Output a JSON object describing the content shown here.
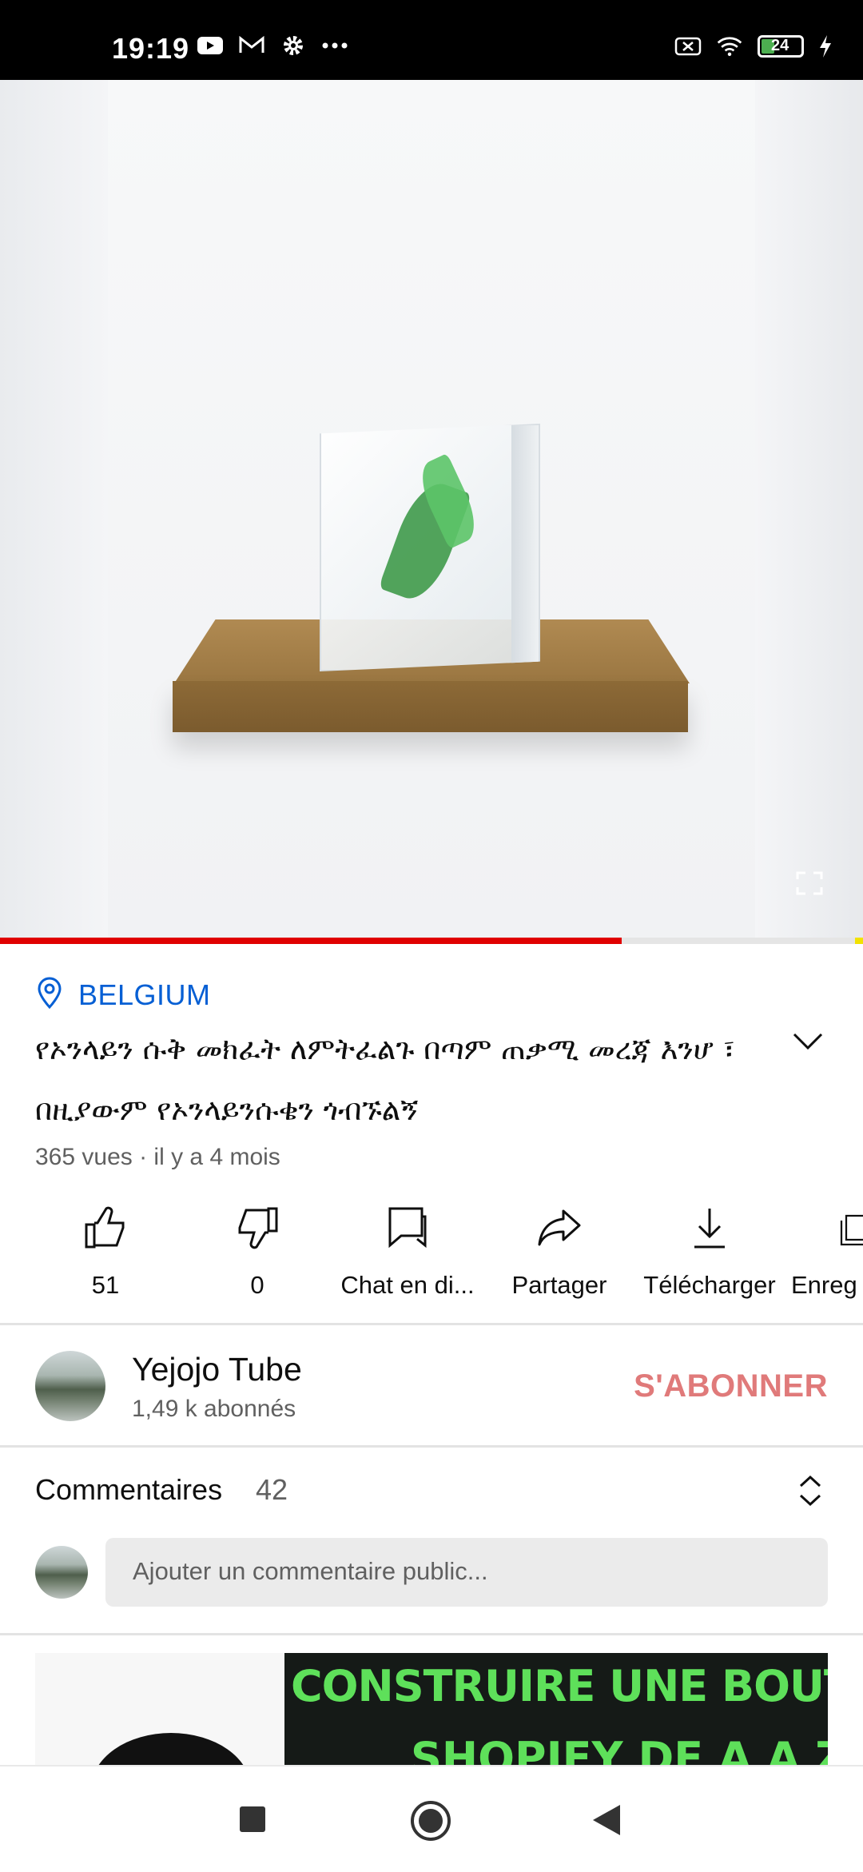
{
  "status_bar": {
    "time": "19:19",
    "battery": "24",
    "icons": [
      "youtube-icon",
      "gmail-icon",
      "settings-icon",
      "more-icon",
      "no-sim-icon",
      "wifi-icon",
      "battery-icon",
      "charging-icon"
    ]
  },
  "video": {
    "progress_fraction": 0.72
  },
  "location": {
    "label": "BELGIUM"
  },
  "video_info": {
    "title": "የኦንላይን ሱቅ መክፈት ለምትፈልጉ በጣም ጠቃሚ መረጃ እንሆ ፣ በዚያውም የኦንላይንሱቄን ጎብኙልኝ",
    "meta": "365 vues · il y a 4 mois"
  },
  "actions": {
    "like": "51",
    "dislike": "0",
    "chat": "Chat en di...",
    "share": "Partager",
    "download": "Télécharger",
    "save": "Enreg"
  },
  "channel": {
    "name": "Yejojo Tube",
    "subscribers": "1,49 k abonnés",
    "subscribe_label": "S'ABONNER"
  },
  "comments": {
    "header": "Commentaires",
    "count": "42",
    "placeholder": "Ajouter un commentaire public..."
  },
  "next_video": {
    "thumb_line1": "CONSTRUIRE UNE BOUTIQUE",
    "thumb_line2": "SHOPIFY DE A A Z"
  },
  "colors": {
    "accent_blue": "#065fd4",
    "progress_red": "#e00000",
    "subscribe_red": "#e07a7a",
    "thumb_green": "#5ee05a"
  }
}
